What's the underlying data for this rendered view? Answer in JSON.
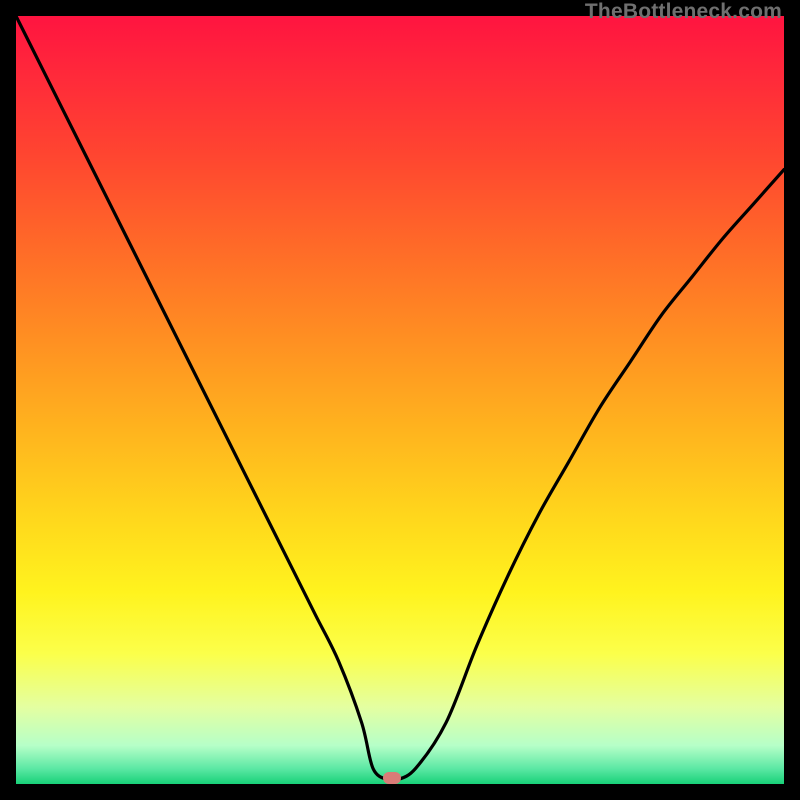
{
  "watermark": "TheBottleneck.com",
  "colors": {
    "curve_stroke": "#000000",
    "marker_fill": "#d97b77",
    "frame_bg": "#000000"
  },
  "chart_data": {
    "type": "line",
    "title": "",
    "xlabel": "",
    "ylabel": "",
    "xlim": [
      0,
      100
    ],
    "ylim": [
      0,
      100
    ],
    "grid": false,
    "legend": false,
    "series": [
      {
        "name": "bottleneck-curve",
        "x": [
          0,
          3,
          6,
          9,
          12,
          15,
          18,
          21,
          24,
          27,
          30,
          33,
          36,
          39,
          42,
          45,
          46.5,
          48.5,
          49.5,
          52,
          56,
          60,
          64,
          68,
          72,
          76,
          80,
          84,
          88,
          92,
          96,
          100
        ],
        "y": [
          100,
          94,
          88,
          82,
          76,
          70,
          64,
          58,
          52,
          46,
          40,
          34,
          28,
          22,
          16,
          8,
          2,
          0.5,
          0.5,
          2,
          8,
          18,
          27,
          35,
          42,
          49,
          55,
          61,
          66,
          71,
          75.5,
          80
        ]
      }
    ],
    "marker": {
      "x": 49,
      "y": 0.8
    },
    "gradient_stops": [
      {
        "pos": 0.0,
        "color": "#ff1440"
      },
      {
        "pos": 0.3,
        "color": "#ff6a28"
      },
      {
        "pos": 0.65,
        "color": "#ffd61c"
      },
      {
        "pos": 0.85,
        "color": "#fbff4a"
      },
      {
        "pos": 1.0,
        "color": "#18d178"
      }
    ]
  }
}
